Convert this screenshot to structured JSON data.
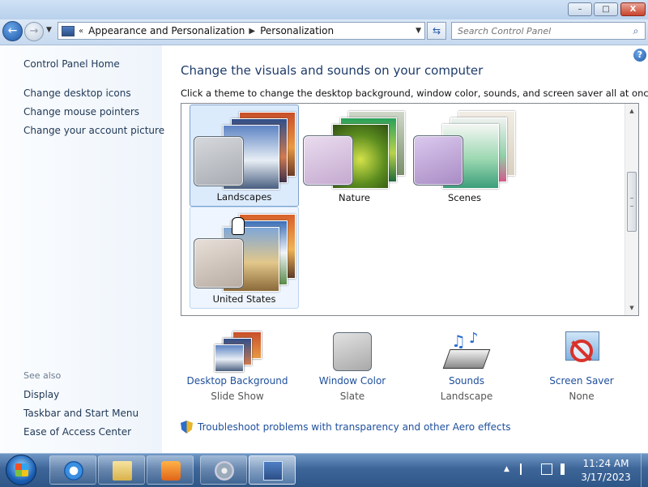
{
  "window": {
    "minimize_glyph": "–",
    "maximize_glyph": "□",
    "close_glyph": "X"
  },
  "nav": {
    "back_glyph": "←",
    "forward_glyph": "→",
    "breadcrumb": [
      "Appearance and Personalization",
      "Personalization"
    ],
    "crumb_sep": "▶",
    "overflow": "«",
    "dropdown_glyph": "▼",
    "refresh_glyph": "⇆",
    "search_placeholder": "Search Control Panel",
    "search_glyph": "⌕"
  },
  "sidebar": {
    "home": "Control Panel Home",
    "links": [
      "Change desktop icons",
      "Change mouse pointers",
      "Change your account picture"
    ],
    "see_also_label": "See also",
    "see_also": [
      "Display",
      "Taskbar and Start Menu",
      "Ease of Access Center"
    ]
  },
  "main": {
    "help_glyph": "?",
    "title": "Change the visuals and sounds on your computer",
    "subtitle": "Click a theme to change the desktop background, window color, sounds, and screen saver all at once.",
    "themes": [
      {
        "name": "Landscapes",
        "selected": true
      },
      {
        "name": "Nature",
        "selected": false
      },
      {
        "name": "Scenes",
        "selected": false
      },
      {
        "name": "United States",
        "selected": false
      }
    ],
    "scroll_up_glyph": "▲",
    "scroll_down_glyph": "▼"
  },
  "settings": [
    {
      "label": "Desktop Background",
      "value": "Slide Show",
      "icon": "desktop-background-icon"
    },
    {
      "label": "Window Color",
      "value": "Slate",
      "icon": "window-color-icon"
    },
    {
      "label": "Sounds",
      "value": "Landscape",
      "icon": "sounds-icon"
    },
    {
      "label": "Screen Saver",
      "value": "None",
      "icon": "screen-saver-icon"
    }
  ],
  "troubleshoot": "Troubleshoot problems with transparency and other Aero effects",
  "taskbar": {
    "tray_up_glyph": "▲",
    "clock_time": "11:24 AM",
    "clock_date": "3/17/2023"
  },
  "colors": {
    "link": "#1e4f9c",
    "title": "#1e3b6b",
    "selection": "#dcebfc"
  }
}
